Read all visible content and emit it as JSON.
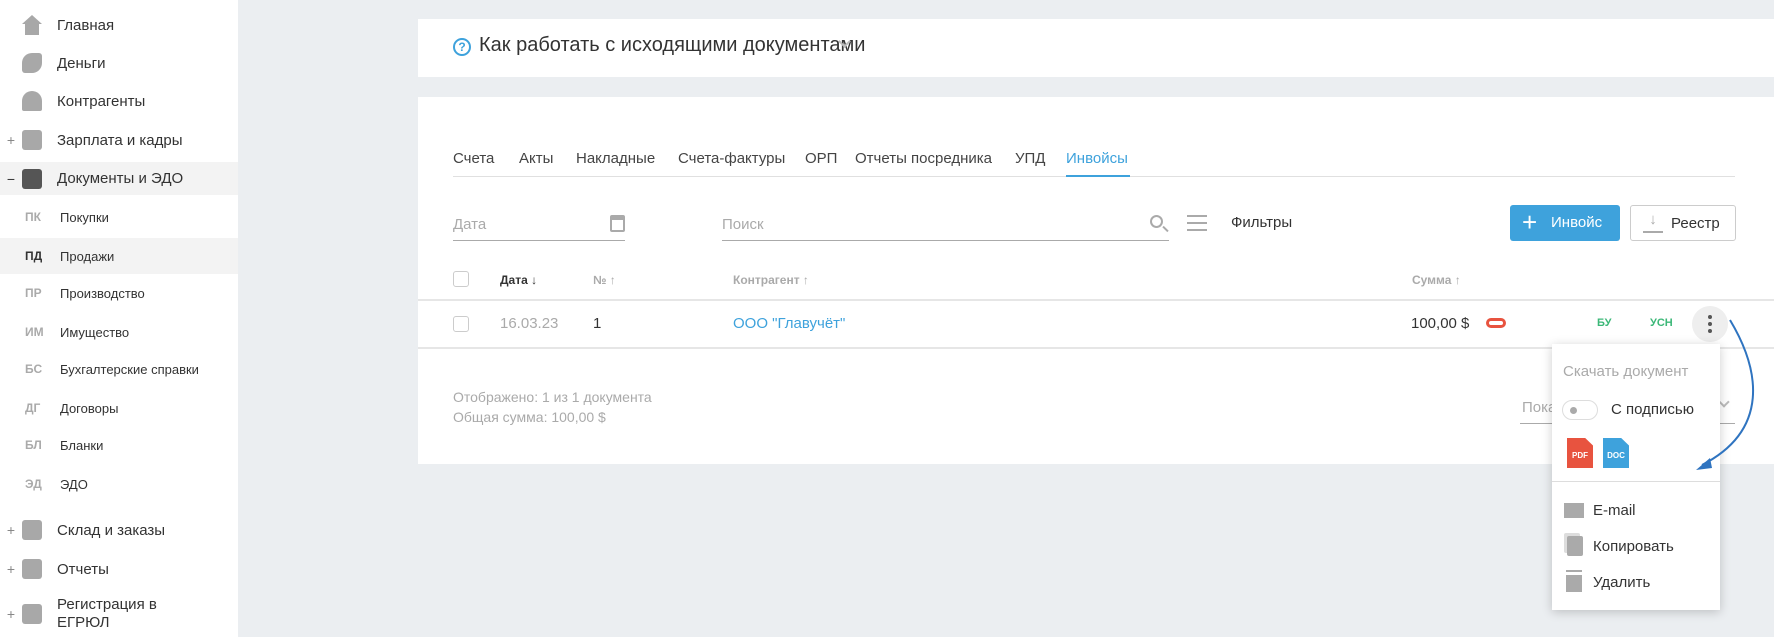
{
  "sidebar": {
    "items": [
      {
        "label": "Главная",
        "expander": ""
      },
      {
        "label": "Деньги",
        "expander": ""
      },
      {
        "label": "Контрагенты",
        "expander": ""
      },
      {
        "label": "Зарплата и кадры",
        "expander": "+"
      },
      {
        "label": "Документы и ЭДО",
        "expander": "−"
      },
      {
        "label": "Склад и заказы",
        "expander": "+"
      },
      {
        "label": "Отчеты",
        "expander": "+"
      },
      {
        "label": "Регистрация в ЕГРЮЛ",
        "expander": "+"
      }
    ],
    "subitems": [
      {
        "abbr": "ПК",
        "label": "Покупки"
      },
      {
        "abbr": "ПД",
        "label": "Продажи"
      },
      {
        "abbr": "ПР",
        "label": "Производство"
      },
      {
        "abbr": "ИМ",
        "label": "Имущество"
      },
      {
        "abbr": "БС",
        "label": "Бухгалтерские справки"
      },
      {
        "abbr": "ДГ",
        "label": "Договоры"
      },
      {
        "abbr": "БЛ",
        "label": "Бланки"
      },
      {
        "abbr": "ЭД",
        "label": "ЭДО"
      }
    ]
  },
  "help": {
    "title": "Как работать с исходящими документами"
  },
  "tabs": [
    "Счета",
    "Акты",
    "Накладные",
    "Счета-фактуры",
    "ОРП",
    "Отчеты посредника",
    "УПД",
    "Инвойсы"
  ],
  "filters": {
    "date_placeholder": "Дата",
    "search_placeholder": "Поиск",
    "filters_label": "Фильтры",
    "invoice_button": "Инвойс",
    "registry_button": "Реестр"
  },
  "table": {
    "headers": {
      "date": "Дата ↓",
      "number": "№ ↑",
      "counterparty": "Контрагент ↑",
      "amount": "Сумма ↑"
    },
    "rows": [
      {
        "date": "16.03.23",
        "number": "1",
        "counterparty": "ООО \"Главучёт\"",
        "amount": "100,00 $",
        "tag1": "БУ",
        "tag2": "УСН"
      }
    ]
  },
  "footer": {
    "shown": "Отображено: 1 из 1 документа",
    "total": "Общая сумма: 100,00 $",
    "show_label": "Пока"
  },
  "menu": {
    "download_title": "Скачать документ",
    "signature_label": "С подписью",
    "signature_on": false,
    "pdf": "PDF",
    "doc": "DOC",
    "email": "E-mail",
    "copy": "Копировать",
    "delete": "Удалить"
  },
  "colors": {
    "accent": "#3ea2dc",
    "green": "#3cb878",
    "red": "#e8533f"
  }
}
